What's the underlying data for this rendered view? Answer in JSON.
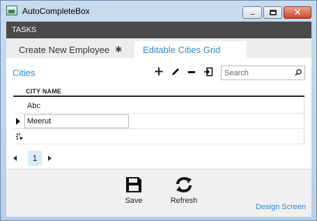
{
  "window": {
    "title": "AutoCompleteBox"
  },
  "tasks": {
    "label": "TASKS"
  },
  "tabs": [
    {
      "label": "Create New Employee",
      "pinned": true
    },
    {
      "label": "Editable Cities Grid",
      "active": true
    }
  ],
  "section": {
    "title": "Cities"
  },
  "toolbar": {
    "icons": [
      "add-icon",
      "edit-icon",
      "delete-icon",
      "export-icon"
    ],
    "search": {
      "placeholder": "Search",
      "value": ""
    }
  },
  "grid": {
    "columns": [
      "CITY NAME"
    ],
    "rows": [
      {
        "city": "Abc"
      },
      {
        "city": "Meerut",
        "editing": true
      }
    ]
  },
  "pager": {
    "current_page": "1"
  },
  "commands": {
    "save_label": "Save",
    "refresh_label": "Refresh"
  },
  "footer": {
    "design_link": "Design Screen"
  },
  "colors": {
    "accent": "#2d8ac9",
    "tasks_bar": "#4a4a4a",
    "active_page": "#d9ecf8"
  }
}
